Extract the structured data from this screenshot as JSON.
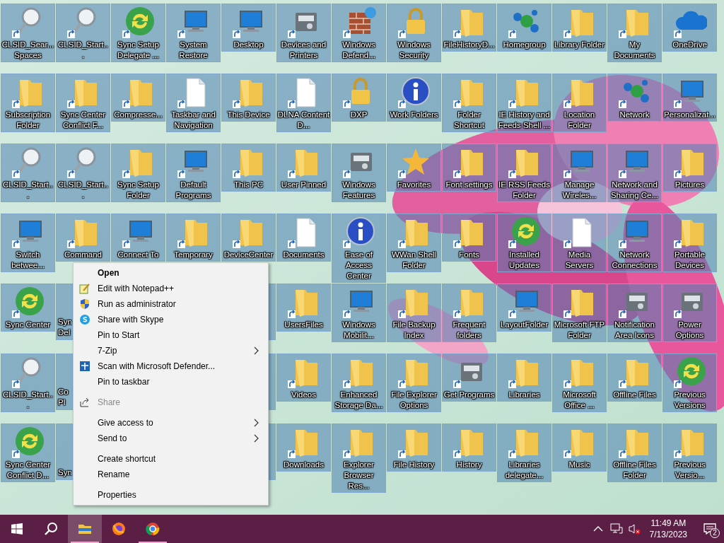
{
  "desktop_icons": [
    [
      {
        "kind": "icon",
        "label": "CLSID_Sear... Spaces",
        "selected": true
      },
      {
        "kind": "icon",
        "label": "CLSID_Start...",
        "selected": true
      },
      {
        "kind": "icon",
        "label": "Sync Setup Delegate ...",
        "selected": true
      },
      {
        "kind": "icon",
        "label": "System Restore",
        "selected": true
      },
      {
        "kind": "icon",
        "label": "Desktop",
        "selected": true
      },
      {
        "kind": "icon",
        "label": "Devices and Printers",
        "selected": true
      },
      {
        "kind": "icon",
        "label": "Windows Defend...",
        "selected": true
      },
      {
        "kind": "icon",
        "label": "Windows Security",
        "selected": true
      },
      {
        "kind": "icon",
        "label": "FileHistoryD...",
        "selected": true
      },
      {
        "kind": "icon",
        "label": "Homegroup",
        "selected": true
      },
      {
        "kind": "icon",
        "label": "Library Folder",
        "selected": true
      },
      {
        "kind": "icon",
        "label": "My Documents",
        "selected": true
      },
      {
        "kind": "icon",
        "label": "OneDrive",
        "selected": true
      }
    ],
    [
      {
        "kind": "icon",
        "label": "Subscription Folder",
        "selected": true
      },
      {
        "kind": "icon",
        "label": "Sync Center Conflict F...",
        "selected": true
      },
      {
        "kind": "icon",
        "label": "Compresse...",
        "selected": true
      },
      {
        "kind": "icon",
        "label": "Taskbar and Navigation",
        "selected": true
      },
      {
        "kind": "icon",
        "label": "This Device",
        "selected": true
      },
      {
        "kind": "icon",
        "label": "DLNA Content D...",
        "selected": true
      },
      {
        "kind": "icon",
        "label": "DXP",
        "selected": true
      },
      {
        "kind": "icon",
        "label": "Work Folders",
        "selected": true
      },
      {
        "kind": "icon",
        "label": "Folder Shortcut",
        "selected": true
      },
      {
        "kind": "icon",
        "label": "IE History and Feeds Shell ...",
        "selected": true
      },
      {
        "kind": "icon",
        "label": "Location Folder",
        "selected": true
      },
      {
        "kind": "icon",
        "label": "Network",
        "selected": true
      },
      {
        "kind": "icon",
        "label": "Personalizat...",
        "selected": true
      }
    ],
    [
      {
        "kind": "icon",
        "label": "CLSID_Start...",
        "selected": true
      },
      {
        "kind": "icon",
        "label": "CLSID_Start...",
        "selected": true
      },
      {
        "kind": "icon",
        "label": "Sync Setup Folder",
        "selected": true
      },
      {
        "kind": "icon",
        "label": "Default Programs",
        "selected": true
      },
      {
        "kind": "icon",
        "label": "This PC",
        "selected": true
      },
      {
        "kind": "icon",
        "label": "User Pinned",
        "selected": true
      },
      {
        "kind": "icon",
        "label": "Windows Features",
        "selected": true
      },
      {
        "kind": "icon",
        "label": "Favorites",
        "selected": true
      },
      {
        "kind": "icon",
        "label": "Font settings",
        "selected": true
      },
      {
        "kind": "icon",
        "label": "IE RSS Feeds Folder",
        "selected": true
      },
      {
        "kind": "icon",
        "label": "Manage Wireles...",
        "selected": true
      },
      {
        "kind": "icon",
        "label": "Network and Sharing Ce...",
        "selected": true
      },
      {
        "kind": "icon",
        "label": "Pictures",
        "selected": true
      }
    ],
    [
      {
        "kind": "icon",
        "label": "Switch betwee...",
        "selected": true
      },
      {
        "kind": "icon",
        "label": "Command",
        "selected": true
      },
      {
        "kind": "icon",
        "label": "Connect To",
        "selected": true
      },
      {
        "kind": "icon",
        "label": "Temporary",
        "selected": true
      },
      {
        "kind": "icon",
        "label": "DeviceCenter",
        "selected": true
      },
      {
        "kind": "icon",
        "label": "Documents",
        "selected": true
      },
      {
        "kind": "icon",
        "label": "Ease of Access Center",
        "selected": true
      },
      {
        "kind": "icon",
        "label": "WWan Shell Folder",
        "selected": true
      },
      {
        "kind": "icon",
        "label": "Fonts",
        "selected": true
      },
      {
        "kind": "icon",
        "label": "Installed Updates",
        "selected": true
      },
      {
        "kind": "icon",
        "label": "Media Servers",
        "selected": true
      },
      {
        "kind": "icon",
        "label": "Network Connections",
        "selected": true
      },
      {
        "kind": "icon",
        "label": "Portable Devices",
        "selected": true
      }
    ],
    [
      {
        "kind": "icon",
        "label": "Sync Center",
        "selected": true
      },
      {
        "kind": "partial",
        "lines": [
          "Syn",
          "Del"
        ],
        "selected": true
      },
      {
        "kind": "covered"
      },
      {
        "kind": "covered"
      },
      {
        "kind": "covered",
        "selected": true
      },
      {
        "kind": "icon",
        "label": "UsersFiles",
        "selected": true
      },
      {
        "kind": "icon",
        "label": "Windows Mobilit...",
        "selected": true
      },
      {
        "kind": "icon",
        "label": "File Backup Index",
        "selected": true
      },
      {
        "kind": "icon",
        "label": "Frequent folders",
        "selected": true
      },
      {
        "kind": "icon",
        "label": "LayoutFolder",
        "selected": true
      },
      {
        "kind": "icon",
        "label": "Microsoft FTP Folder",
        "selected": true
      },
      {
        "kind": "icon",
        "label": "Notification Area Icons",
        "selected": true
      },
      {
        "kind": "icon",
        "label": "Power Options",
        "selected": true
      }
    ],
    [
      {
        "kind": "icon",
        "label": "CLSID_Start...",
        "selected": true
      },
      {
        "kind": "partial",
        "lines": [
          "Co",
          "Pl"
        ],
        "selected": true
      },
      {
        "kind": "covered"
      },
      {
        "kind": "covered"
      },
      {
        "kind": "covered",
        "selected": true
      },
      {
        "kind": "icon",
        "label": "Videos",
        "selected": true
      },
      {
        "kind": "icon",
        "label": "Enhanced Storage Da...",
        "selected": true
      },
      {
        "kind": "icon",
        "label": "File Explorer Options",
        "selected": true
      },
      {
        "kind": "icon",
        "label": "Get Programs",
        "selected": true
      },
      {
        "kind": "icon",
        "label": "Libraries",
        "selected": true
      },
      {
        "kind": "icon",
        "label": "Microsoft Office ...",
        "selected": true
      },
      {
        "kind": "icon",
        "label": "Offline Files",
        "selected": true
      },
      {
        "kind": "icon",
        "label": "Previous Versions",
        "selected": true
      }
    ],
    [
      {
        "kind": "icon",
        "label": "Sync Center Conflict D...",
        "selected": true
      },
      {
        "kind": "partial",
        "lines": [
          "Syn"
        ],
        "selected": true
      },
      {
        "kind": "covered"
      },
      {
        "kind": "covered"
      },
      {
        "kind": "covered",
        "selected": true
      },
      {
        "kind": "icon",
        "label": "Downloads",
        "selected": true
      },
      {
        "kind": "icon",
        "label": "Explorer Browser Res...",
        "selected": true
      },
      {
        "kind": "icon",
        "label": "File History",
        "selected": true
      },
      {
        "kind": "icon",
        "label": "History",
        "selected": true
      },
      {
        "kind": "icon",
        "label": "Libraries delegate...",
        "selected": true
      },
      {
        "kind": "icon",
        "label": "Music",
        "selected": true
      },
      {
        "kind": "icon",
        "label": "Offline Files Folder",
        "selected": true
      },
      {
        "kind": "icon",
        "label": "Previous Versio...",
        "selected": true
      }
    ]
  ],
  "context_menu": [
    {
      "kind": "item",
      "label": "Open",
      "default": true
    },
    {
      "kind": "item",
      "label": "Edit with Notepad++"
    },
    {
      "kind": "item",
      "label": "Run as administrator"
    },
    {
      "kind": "item",
      "label": "Share with Skype"
    },
    {
      "kind": "item",
      "label": "Pin to Start"
    },
    {
      "kind": "item",
      "label": "7-Zip",
      "submenu": true
    },
    {
      "kind": "item",
      "label": "Scan with Microsoft Defender..."
    },
    {
      "kind": "item",
      "label": "Pin to taskbar"
    },
    {
      "kind": "separator"
    },
    {
      "kind": "item",
      "label": "Share",
      "disabled": true
    },
    {
      "kind": "separator"
    },
    {
      "kind": "item",
      "label": "Give access to",
      "submenu": true
    },
    {
      "kind": "item",
      "label": "Send to",
      "submenu": true
    },
    {
      "kind": "separator"
    },
    {
      "kind": "item",
      "label": "Create shortcut"
    },
    {
      "kind": "item",
      "label": "Rename"
    },
    {
      "kind": "separator"
    },
    {
      "kind": "item",
      "label": "Properties"
    }
  ],
  "taskbar": {
    "apps": [
      {
        "selected": true,
        "running": true
      },
      {
        "selected": false,
        "running": false
      },
      {
        "selected": false,
        "running": true
      }
    ],
    "time": "11:49 AM",
    "date": "7/13/2023",
    "notification_count": "2"
  }
}
